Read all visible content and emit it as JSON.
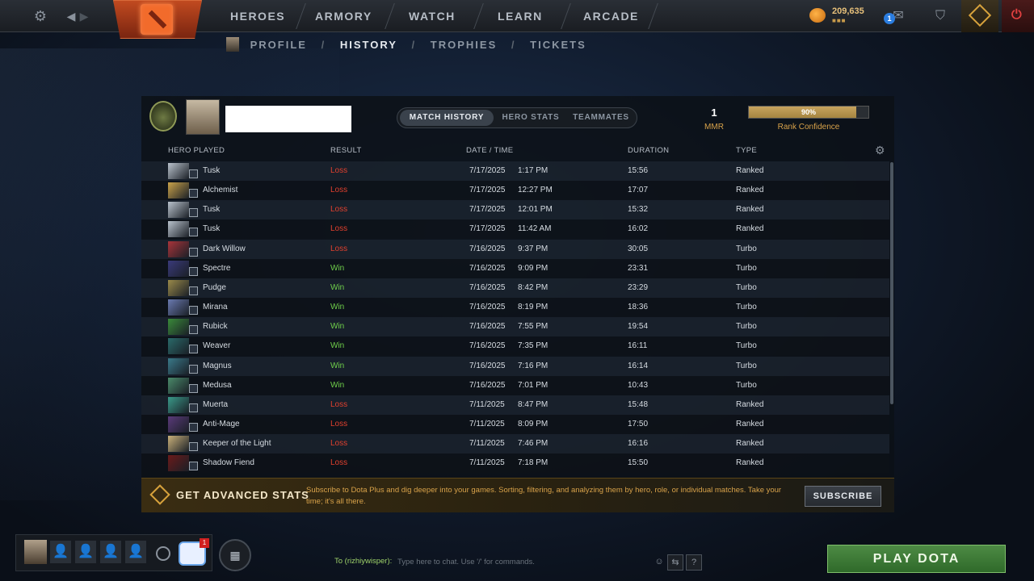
{
  "topbar": {
    "nav": [
      "HEROES",
      "ARMORY",
      "WATCH",
      "LEARN",
      "ARCADE"
    ],
    "currency": "209,635",
    "notification_count": "1"
  },
  "subnav": {
    "items": [
      "PROFILE",
      "HISTORY",
      "TROPHIES",
      "TICKETS"
    ],
    "active": "HISTORY"
  },
  "header": {
    "tabs": [
      "MATCH HISTORY",
      "HERO STATS",
      "TEAMMATES"
    ],
    "mmr_value": "1",
    "mmr_label": "MMR",
    "rank_confidence_pct": 90,
    "rank_confidence_text": "90%",
    "rank_confidence_label": "Rank Confidence"
  },
  "columns": [
    "HERO PLAYED",
    "RESULT",
    "DATE / TIME",
    "DURATION",
    "TYPE"
  ],
  "matches": [
    {
      "hero": "Tusk",
      "result": "Loss",
      "date": "7/17/2025",
      "time": "1:17 PM",
      "duration": "15:56",
      "type": "Ranked",
      "color": "#b9c2cc"
    },
    {
      "hero": "Alchemist",
      "result": "Loss",
      "date": "7/17/2025",
      "time": "12:27 PM",
      "duration": "17:07",
      "type": "Ranked",
      "color": "#c9a24a"
    },
    {
      "hero": "Tusk",
      "result": "Loss",
      "date": "7/17/2025",
      "time": "12:01 PM",
      "duration": "15:32",
      "type": "Ranked",
      "color": "#b9c2cc"
    },
    {
      "hero": "Tusk",
      "result": "Loss",
      "date": "7/17/2025",
      "time": "11:42 AM",
      "duration": "16:02",
      "type": "Ranked",
      "color": "#b9c2cc"
    },
    {
      "hero": "Dark Willow",
      "result": "Loss",
      "date": "7/16/2025",
      "time": "9:37 PM",
      "duration": "30:05",
      "type": "Turbo",
      "color": "#a8343a"
    },
    {
      "hero": "Spectre",
      "result": "Win",
      "date": "7/16/2025",
      "time": "9:09 PM",
      "duration": "23:31",
      "type": "Turbo",
      "color": "#3a3a7a"
    },
    {
      "hero": "Pudge",
      "result": "Win",
      "date": "7/16/2025",
      "time": "8:42 PM",
      "duration": "23:29",
      "type": "Turbo",
      "color": "#9a8a4a"
    },
    {
      "hero": "Mirana",
      "result": "Win",
      "date": "7/16/2025",
      "time": "8:19 PM",
      "duration": "18:36",
      "type": "Turbo",
      "color": "#6a7ab0"
    },
    {
      "hero": "Rubick",
      "result": "Win",
      "date": "7/16/2025",
      "time": "7:55 PM",
      "duration": "19:54",
      "type": "Turbo",
      "color": "#3a8a3a"
    },
    {
      "hero": "Weaver",
      "result": "Win",
      "date": "7/16/2025",
      "time": "7:35 PM",
      "duration": "16:11",
      "type": "Turbo",
      "color": "#2a6a6a"
    },
    {
      "hero": "Magnus",
      "result": "Win",
      "date": "7/16/2025",
      "time": "7:16 PM",
      "duration": "16:14",
      "type": "Turbo",
      "color": "#3a7a8a"
    },
    {
      "hero": "Medusa",
      "result": "Win",
      "date": "7/16/2025",
      "time": "7:01 PM",
      "duration": "10:43",
      "type": "Turbo",
      "color": "#4a8a6a"
    },
    {
      "hero": "Muerta",
      "result": "Loss",
      "date": "7/11/2025",
      "time": "8:47 PM",
      "duration": "15:48",
      "type": "Ranked",
      "color": "#3a9a8a"
    },
    {
      "hero": "Anti-Mage",
      "result": "Loss",
      "date": "7/11/2025",
      "time": "8:09 PM",
      "duration": "17:50",
      "type": "Ranked",
      "color": "#5a3a7a"
    },
    {
      "hero": "Keeper of the Light",
      "result": "Loss",
      "date": "7/11/2025",
      "time": "7:46 PM",
      "duration": "16:16",
      "type": "Ranked",
      "color": "#c9b07a"
    },
    {
      "hero": "Shadow Fiend",
      "result": "Loss",
      "date": "7/11/2025",
      "time": "7:18 PM",
      "duration": "15:50",
      "type": "Ranked",
      "color": "#6a1a1a"
    }
  ],
  "colors": {
    "loss": "#e0402e",
    "win": "#6fcf4a",
    "accent_gold": "#d8a24a"
  },
  "promo": {
    "title": "GET ADVANCED STATS",
    "text": "Subscribe to Dota Plus and dig deeper into your games. Sorting, filtering, and analyzing them by hero, role, or individual matches. Take your time; it's all there.",
    "button": "SUBSCRIBE"
  },
  "party": {
    "notification_count": "1"
  },
  "chat": {
    "to_label": "To (rizhiywisper):",
    "placeholder": "Type here to chat. Use '/' for commands."
  },
  "play_button": "PLAY DOTA",
  "icons": {
    "settings": "gear-icon",
    "back_forward": "arrow-icons",
    "logo": "dota-logo-icon",
    "shards": "shards-icon",
    "mail": "mail-icon",
    "armory": "armory-icon",
    "dota_plus": "dota-plus-icon",
    "power": "power-icon"
  }
}
